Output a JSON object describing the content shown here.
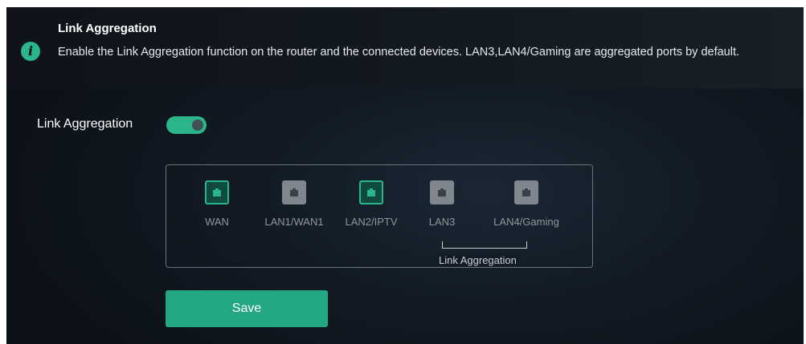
{
  "banner": {
    "icon": "info-icon",
    "icon_glyph": "i",
    "title": "Link Aggregation",
    "description": "Enable the Link Aggregation function on the router and the connected devices. LAN3,LAN4/Gaming are aggregated ports by default."
  },
  "toggle": {
    "label": "Link Aggregation",
    "state": "on"
  },
  "ports": [
    {
      "label": "WAN",
      "state": "active",
      "icon": "ethernet-port-icon"
    },
    {
      "label": "LAN1/WAN1",
      "state": "inactive",
      "icon": "ethernet-port-icon"
    },
    {
      "label": "LAN2/IPTV",
      "state": "active",
      "icon": "ethernet-port-icon"
    },
    {
      "label": "LAN3",
      "state": "inactive",
      "icon": "ethernet-port-icon"
    },
    {
      "label": "LAN4/Gaming",
      "state": "inactive",
      "icon": "ethernet-port-icon"
    }
  ],
  "aggregation_label": "Link Aggregation",
  "save_label": "Save",
  "colors": {
    "accent": "#2bb58a",
    "inactive_port": "#7f868d",
    "background": "#121b25"
  }
}
